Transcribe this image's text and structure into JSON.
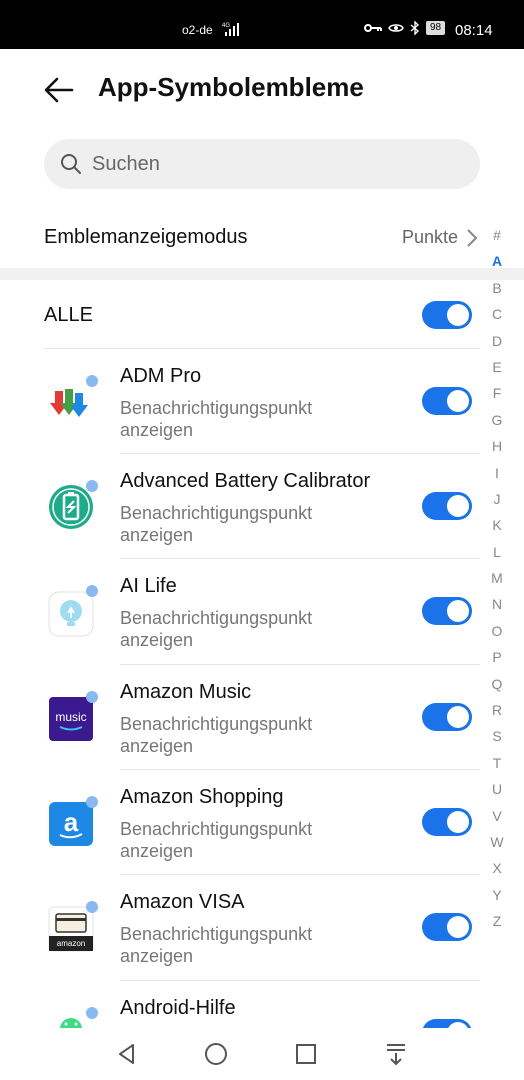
{
  "status_bar": {
    "carrier": "o2-de",
    "network": "4G",
    "battery": "98",
    "time": "08:14"
  },
  "header": {
    "title": "App-Symbolembleme"
  },
  "search": {
    "placeholder": "Suchen"
  },
  "mode": {
    "label": "Emblemanzeigemodus",
    "value": "Punkte"
  },
  "all_toggle": {
    "label": "ALLE",
    "on": true
  },
  "apps": [
    {
      "name": "ADM Pro",
      "subtitle": "Benachrichtigungspunkt anzeigen",
      "icon": "adm-pro-icon",
      "on": true
    },
    {
      "name": "Advanced Battery Calibrator",
      "subtitle": "Benachrichtigungspunkt anzeigen",
      "icon": "battery-calibrator-icon",
      "on": true
    },
    {
      "name": "AI Life",
      "subtitle": "Benachrichtigungspunkt anzeigen",
      "icon": "ai-life-icon",
      "on": true
    },
    {
      "name": "Amazon Music",
      "subtitle": "Benachrichtigungspunkt anzeigen",
      "icon": "amazon-music-icon",
      "icon_text": "music",
      "on": true
    },
    {
      "name": "Amazon Shopping",
      "subtitle": "Benachrichtigungspunkt anzeigen",
      "icon": "amazon-shopping-icon",
      "on": true
    },
    {
      "name": "Amazon VISA",
      "subtitle": "Benachrichtigungspunkt anzeigen",
      "icon": "amazon-visa-icon",
      "icon_text": "amazon",
      "on": true
    },
    {
      "name": "Android-Hilfe",
      "subtitle": "",
      "icon": "android-help-icon",
      "on": true
    }
  ],
  "alphabet": [
    "#",
    "A",
    "B",
    "C",
    "D",
    "E",
    "F",
    "G",
    "H",
    "I",
    "J",
    "K",
    "L",
    "M",
    "N",
    "O",
    "P",
    "Q",
    "R",
    "S",
    "T",
    "U",
    "V",
    "W",
    "X",
    "Y",
    "Z"
  ],
  "alphabet_active": "A",
  "colors": {
    "accent": "#1a73e8",
    "badge_dot": "#8ab8f0"
  }
}
